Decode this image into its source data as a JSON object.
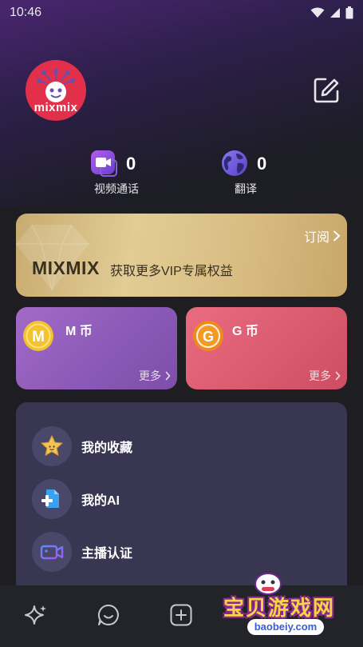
{
  "status_bar": {
    "time": "10:46"
  },
  "profile": {
    "avatar_text": "mixmix"
  },
  "stats": [
    {
      "icon": "video-call-icon",
      "value": "0",
      "label": "视频通话"
    },
    {
      "icon": "globe-icon",
      "value": "0",
      "label": "翻译"
    }
  ],
  "vip": {
    "subscribe_label": "订阅",
    "brand": "MIXMIX",
    "description": "获取更多VIP专属权益"
  },
  "coins": [
    {
      "icon_letter": "M",
      "title": "M 币",
      "more_label": "更多"
    },
    {
      "icon_letter": "G",
      "title": "G 币",
      "more_label": "更多"
    }
  ],
  "menu": [
    {
      "icon": "star-icon",
      "label": "我的收藏"
    },
    {
      "icon": "ai-document-icon",
      "label": "我的AI"
    },
    {
      "icon": "camera-icon",
      "label": "主播认证"
    }
  ],
  "bottom_nav": [
    {
      "icon": "sparkle-icon"
    },
    {
      "icon": "chat-bubble-icon"
    },
    {
      "icon": "add-square-icon"
    }
  ],
  "watermark": {
    "title": "宝贝游戏网",
    "url": "baobeiy.com"
  },
  "colors": {
    "vip_gold": "#d9be84",
    "m_coin_purple": "#8a58b6",
    "g_coin_red": "#d9596d",
    "menu_card": "#383650",
    "coin_gold": "#f2c230",
    "coin_orange": "#f08a1c"
  }
}
